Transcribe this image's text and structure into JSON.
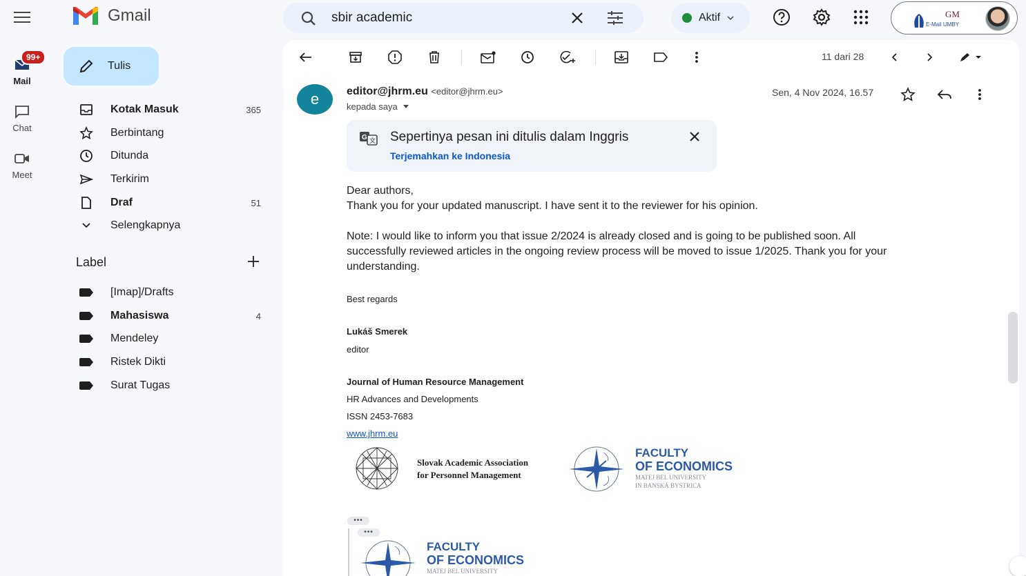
{
  "header": {
    "app_name": "Gmail",
    "search_query": "sbir academic",
    "status": "Aktif",
    "account_org_logo": "GM",
    "account_org_label": "E-Mail UMBY"
  },
  "rail": {
    "mail": {
      "label": "Mail",
      "badge": "99+"
    },
    "chat": {
      "label": "Chat"
    },
    "meet": {
      "label": "Meet"
    }
  },
  "sidebar": {
    "compose_label": "Tulis",
    "nav": [
      {
        "label": "Kotak Masuk",
        "count": "365",
        "icon": "inbox-icon"
      },
      {
        "label": "Berbintang",
        "count": "",
        "icon": "star-icon"
      },
      {
        "label": "Ditunda",
        "count": "",
        "icon": "clock-icon"
      },
      {
        "label": "Terkirim",
        "count": "",
        "icon": "send-icon"
      },
      {
        "label": "Draf",
        "count": "51",
        "icon": "draft-icon"
      },
      {
        "label": "Selengkapnya",
        "count": "",
        "icon": "chevron-down-icon"
      }
    ],
    "labels_heading": "Label",
    "labels": [
      {
        "label": "[Imap]/Drafts",
        "count": ""
      },
      {
        "label": "Mahasiswa",
        "count": "4"
      },
      {
        "label": "Mendeley",
        "count": ""
      },
      {
        "label": "Ristek Dikti",
        "count": ""
      },
      {
        "label": "Surat Tugas",
        "count": ""
      }
    ]
  },
  "toolbar": {
    "pager": "11 dari 28"
  },
  "message": {
    "avatar_letter": "e",
    "sender_name": "editor@jhrm.eu",
    "sender_address": "<editor@jhrm.eu>",
    "to": "kepada saya",
    "date": "Sen, 4 Nov 2024, 16.57",
    "translate": {
      "title": "Sepertinya pesan ini ditulis dalam Inggris",
      "link": "Terjemahkan ke Indonesia"
    },
    "body": {
      "greeting": "Dear authors,",
      "line1": "Thank you for your updated manuscript. I have sent it to the reviewer for his opinion.",
      "note_line1": "Note: I would like to inform you that issue 2/2024 is already closed and is going to be published soon. All",
      "note_line2": "successfully reviewed articles in the ongoing review process will be moved to issue 1/2025. Thank you for your",
      "note_line3": "understanding.",
      "regards": "Best regards",
      "sig_name": "Lukáš Smerek",
      "sig_role": "editor",
      "journal": "Journal of Human Resource Management",
      "journal_sub": "HR Advances and Developments",
      "issn": "ISSN 2453-7683",
      "website": "www.jhrm.eu"
    },
    "logos": {
      "assoc_line1": "Slovak Academic Association",
      "assoc_line2": "for Personnel Management",
      "fac_line1": "FACULTY",
      "fac_line2": "OF ECONOMICS",
      "fac_line3": "MATEJ BEL UNIVERSITY",
      "fac_line4": "IN BANSKÁ BYSTRICA",
      "fac2_line1": "FACULTY",
      "fac2_line2": "OF ECONOMICS",
      "fac2_line3": "MATEJ BEL UNIVERSITY"
    },
    "ellipsis": "•••"
  },
  "colors": {
    "accent": "#0b57d0",
    "compose_bg": "#c2e7ff",
    "status_green": "#1e8e3e",
    "badge_red": "#c5221f",
    "avatar_teal": "#12849b"
  }
}
